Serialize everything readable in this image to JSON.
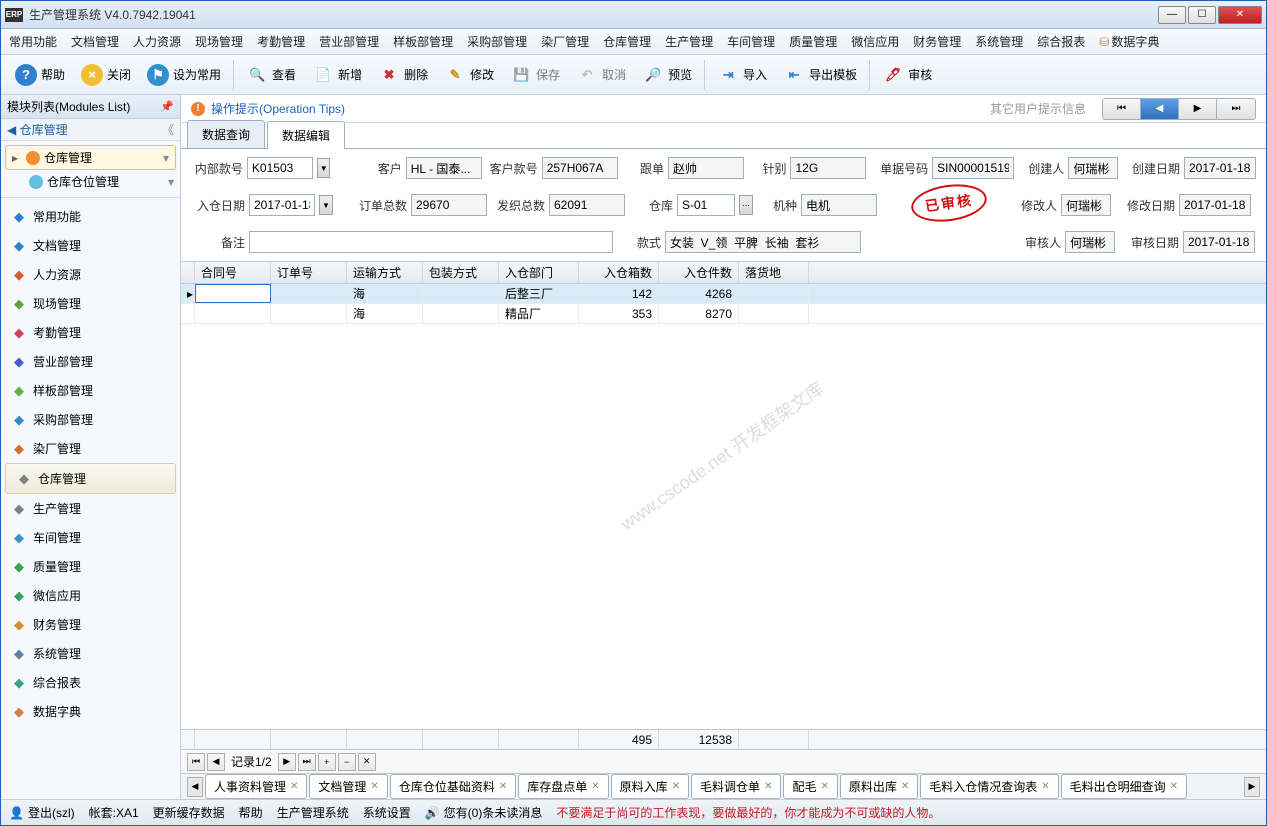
{
  "window": {
    "title": "生产管理系统 V4.0.7942.19041",
    "erp": "ERP"
  },
  "menubar": [
    "常用功能",
    "文档管理",
    "人力资源",
    "现场管理",
    "考勤管理",
    "营业部管理",
    "样板部管理",
    "采购部管理",
    "染厂管理",
    "仓库管理",
    "生产管理",
    "车间管理",
    "质量管理",
    "微信应用",
    "财务管理",
    "系统管理",
    "综合报表"
  ],
  "data_dict": "数据字典",
  "toolbar": {
    "help": "帮助",
    "close": "关闭",
    "set_common": "设为常用",
    "view": "查看",
    "add": "新增",
    "delete": "删除",
    "edit": "修改",
    "save": "保存",
    "cancel": "取消",
    "preview": "预览",
    "import": "导入",
    "export_tpl": "导出模板",
    "audit": "审核"
  },
  "sidebar": {
    "title": "模块列表(Modules List)",
    "nav": "仓库管理",
    "tree_root": "仓库管理",
    "tree_child": "仓库仓位管理",
    "items": [
      {
        "label": "常用功能",
        "color": "#3080d0"
      },
      {
        "label": "文档管理",
        "color": "#3080d0"
      },
      {
        "label": "人力资源",
        "color": "#d06030"
      },
      {
        "label": "现场管理",
        "color": "#60a040"
      },
      {
        "label": "考勤管理",
        "color": "#d04060"
      },
      {
        "label": "营业部管理",
        "color": "#4060c0"
      },
      {
        "label": "样板部管理",
        "color": "#60b050"
      },
      {
        "label": "采购部管理",
        "color": "#3090c0"
      },
      {
        "label": "染厂管理",
        "color": "#d07030"
      },
      {
        "label": "仓库管理",
        "color": "#808080",
        "active": true
      },
      {
        "label": "生产管理",
        "color": "#808080"
      },
      {
        "label": "车间管理",
        "color": "#4090c0"
      },
      {
        "label": "质量管理",
        "color": "#40a050"
      },
      {
        "label": "微信应用",
        "color": "#40a060"
      },
      {
        "label": "财务管理",
        "color": "#d09030"
      },
      {
        "label": "系统管理",
        "color": "#6080a0"
      },
      {
        "label": "综合报表",
        "color": "#40a080"
      },
      {
        "label": "数据字典",
        "color": "#d08040"
      }
    ]
  },
  "tips": {
    "label": "操作提示(Operation Tips)",
    "other": "其它用户提示信息"
  },
  "subtabs": {
    "query": "数据查询",
    "edit": "数据编辑"
  },
  "form": {
    "l_internal": "内部款号",
    "v_internal": "K01503",
    "l_customer": "客户",
    "v_customer": "HL - 国泰...",
    "l_custno": "客户款号",
    "v_custno": "257H067A",
    "l_follow": "跟单",
    "v_follow": "赵帅",
    "l_needle": "针别",
    "v_needle": "12G",
    "l_docno": "单据号码",
    "v_docno": "SIN00001519",
    "l_creator": "创建人",
    "v_creator": "何瑞彬",
    "l_cdate": "创建日期",
    "v_cdate": "2017-01-18",
    "l_indate": "入仓日期",
    "v_indate": "2017-01-18",
    "l_ordertotal": "订单总数",
    "v_ordertotal": "29670",
    "l_shiptotal": "发织总数",
    "v_shiptotal": "62091",
    "l_wh": "仓库",
    "v_wh": "S-01",
    "l_machine": "机种",
    "v_machine": "电机",
    "l_modifier": "修改人",
    "v_modifier": "何瑞彬",
    "l_mdate": "修改日期",
    "v_mdate": "2017-01-18",
    "l_remark": "备注",
    "v_remark": "",
    "l_style": "款式",
    "v_style": "女装  V_领  平脾  长袖  套衫",
    "l_auditor": "审核人",
    "v_auditor": "何瑞彬",
    "l_adate": "审核日期",
    "v_adate": "2017-01-18",
    "stamp": "已审核"
  },
  "grid": {
    "cols": [
      "合同号",
      "订单号",
      "运输方式",
      "包装方式",
      "入仓部门",
      "入仓箱数",
      "入仓件数",
      "落货地"
    ],
    "rows": [
      {
        "contract": "",
        "order": "",
        "ship": "海",
        "pack": "",
        "dept": "后整三厂",
        "boxes": "142",
        "pcs": "4268",
        "dest": ""
      },
      {
        "contract": "",
        "order": "",
        "ship": "海",
        "pack": "",
        "dept": "精品厂",
        "boxes": "353",
        "pcs": "8270",
        "dest": ""
      }
    ],
    "sum_boxes": "495",
    "sum_pcs": "12538",
    "watermark": "www.cscode.net\n开发框架文库"
  },
  "recnav": {
    "label": "记录1/2"
  },
  "bottabs": [
    "人事资料管理",
    "文档管理",
    "仓库仓位基础资料",
    "库存盘点单",
    "原料入库",
    "毛料调仓单",
    "配毛",
    "原料出库",
    "毛料入仓情况查询表",
    "毛料出仓明细查询"
  ],
  "statusbar": {
    "login": "登出(szl)",
    "acct": "帐套:XA1",
    "refresh": "更新缓存数据",
    "help": "帮助",
    "sys": "生产管理系统",
    "settings": "系统设置",
    "msg": "您有(0)条未读消息",
    "quote": "不要满足于尚可的工作表现，要做最好的，你才能成为不可或缺的人物。"
  }
}
